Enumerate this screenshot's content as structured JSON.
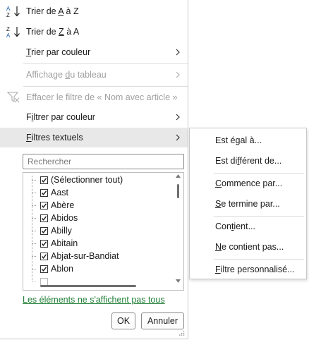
{
  "menu": {
    "sort_az": {
      "pre": "Trier de ",
      "u": "A",
      "post": " à Z"
    },
    "sort_za": {
      "pre": "Trier de ",
      "u": "Z",
      "post": " à A"
    },
    "sort_color": {
      "u": "T",
      "post": "rier par couleur"
    },
    "sheet_view": {
      "pre": "Affichage ",
      "u": "d",
      "post": "u tableau"
    },
    "clear_filter": {
      "pre": "Effacer le filtre de « Nom avec article »"
    },
    "filter_color": {
      "pre": "F",
      "u": "i",
      "post": "ltrer par couleur"
    },
    "text_filters": {
      "u": "F",
      "post": "iltres textuels"
    }
  },
  "search": {
    "placeholder": "Rechercher"
  },
  "list": {
    "items": [
      "(Sélectionner tout)",
      "Aast",
      "Abère",
      "Abidos",
      "Abilly",
      "Abitain",
      "Abjat-sur-Bandiat",
      "Ablon"
    ]
  },
  "footer": {
    "link": "Les éléments ne s'affichent pas tous",
    "ok": "OK",
    "cancel": "Annuler"
  },
  "submenu": {
    "equals": {
      "pre": "Est é",
      "u": "g",
      "post": "al à..."
    },
    "not_equal": {
      "pre": "Est di",
      "u": "f",
      "post": "férent de..."
    },
    "begins": {
      "u": "C",
      "post": "ommence par..."
    },
    "ends": {
      "u": "S",
      "post": "e termine par..."
    },
    "contains": {
      "pre": "Con",
      "u": "t",
      "post": "ient..."
    },
    "not_contains": {
      "u": "N",
      "post": "e contient pas..."
    },
    "custom": {
      "u": "F",
      "post": "iltre personnalisé..."
    }
  },
  "colors": {
    "link": "#1e7e34",
    "check": "#1a1a1a",
    "sort_blue": "#1f5fb0"
  }
}
